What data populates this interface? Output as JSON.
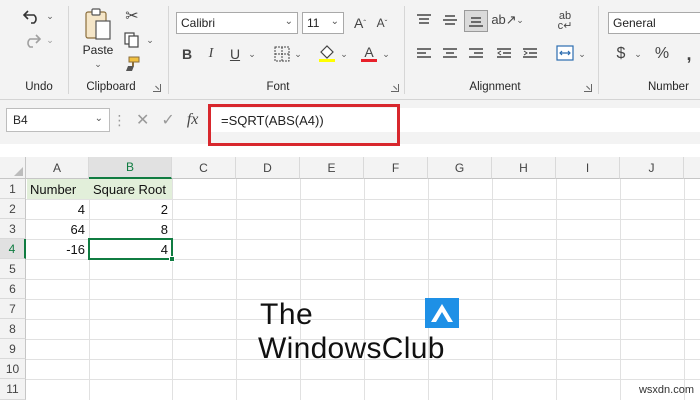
{
  "ribbon": {
    "groups": {
      "undo": "Undo",
      "clipboard": "Clipboard",
      "font": "Font",
      "alignment": "Alignment",
      "number": "Number"
    },
    "paste_label": "Paste",
    "font_name": "Calibri",
    "font_size": "11",
    "number_format": "General",
    "bold_label": "B",
    "italic_label": "I",
    "underline_label": "U"
  },
  "formula_bar": {
    "name_box": "B4",
    "fx_label": "fx",
    "formula": "=SQRT(ABS(A4))"
  },
  "sheet": {
    "columns": [
      "A",
      "B",
      "C",
      "D",
      "E",
      "F",
      "G",
      "H",
      "I",
      "J"
    ],
    "rows": [
      "1",
      "2",
      "3",
      "4",
      "5",
      "6",
      "7",
      "8",
      "9",
      "10",
      "11"
    ],
    "active_cell": "B4",
    "cells": {
      "A1": "Number",
      "B1": "Square Root",
      "A2": "4",
      "B2": "2",
      "A3": "64",
      "B3": "8",
      "A4": "-16",
      "B4": "4"
    }
  },
  "watermark": {
    "line1": "The",
    "line2": "WindowsClub",
    "logo_color": "#1e90e6"
  },
  "site_credit": "wsxdn.com",
  "colors": {
    "accent": "#107c41",
    "highlight_box": "#d8272d",
    "header_fill": "#e2efda"
  }
}
